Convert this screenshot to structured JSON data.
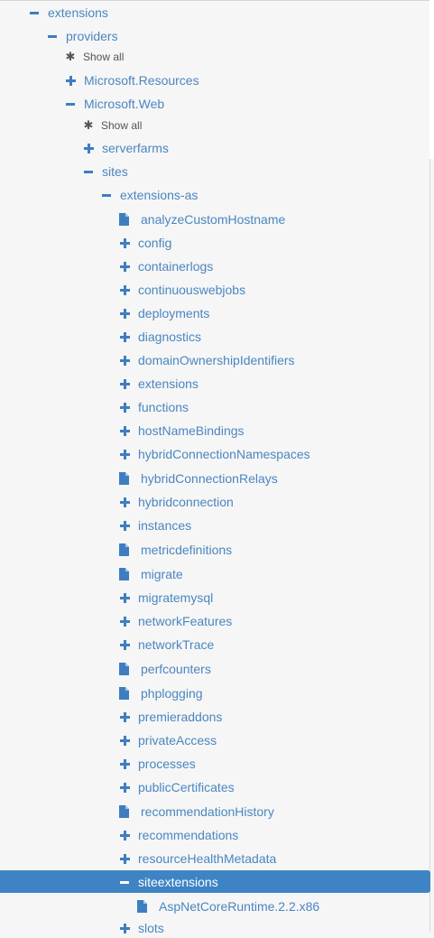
{
  "tree": [
    {
      "label": "extensions",
      "icon": "minus",
      "level": 0
    },
    {
      "label": "providers",
      "icon": "minus",
      "level": 1
    },
    {
      "label": "Show all",
      "icon": "star",
      "level": 2
    },
    {
      "label": "Microsoft.Resources",
      "icon": "plus",
      "level": 2
    },
    {
      "label": "Microsoft.Web",
      "icon": "minus",
      "level": 2
    },
    {
      "label": "Show all",
      "icon": "star",
      "level": 3
    },
    {
      "label": "serverfarms",
      "icon": "plus",
      "level": 3
    },
    {
      "label": "sites",
      "icon": "minus",
      "level": 3
    },
    {
      "label": "extensions-as",
      "icon": "minus",
      "level": 4
    },
    {
      "label": "analyzeCustomHostname",
      "icon": "file",
      "level": 5
    },
    {
      "label": "config",
      "icon": "plus",
      "level": 5
    },
    {
      "label": "containerlogs",
      "icon": "plus",
      "level": 5
    },
    {
      "label": "continuouswebjobs",
      "icon": "plus",
      "level": 5
    },
    {
      "label": "deployments",
      "icon": "plus",
      "level": 5
    },
    {
      "label": "diagnostics",
      "icon": "plus",
      "level": 5
    },
    {
      "label": "domainOwnershipIdentifiers",
      "icon": "plus",
      "level": 5
    },
    {
      "label": "extensions",
      "icon": "plus",
      "level": 5
    },
    {
      "label": "functions",
      "icon": "plus",
      "level": 5
    },
    {
      "label": "hostNameBindings",
      "icon": "plus",
      "level": 5
    },
    {
      "label": "hybridConnectionNamespaces",
      "icon": "plus",
      "level": 5
    },
    {
      "label": "hybridConnectionRelays",
      "icon": "file",
      "level": 5
    },
    {
      "label": "hybridconnection",
      "icon": "plus",
      "level": 5
    },
    {
      "label": "instances",
      "icon": "plus",
      "level": 5
    },
    {
      "label": "metricdefinitions",
      "icon": "file",
      "level": 5
    },
    {
      "label": "migrate",
      "icon": "file",
      "level": 5
    },
    {
      "label": "migratemysql",
      "icon": "plus",
      "level": 5
    },
    {
      "label": "networkFeatures",
      "icon": "plus",
      "level": 5
    },
    {
      "label": "networkTrace",
      "icon": "plus",
      "level": 5
    },
    {
      "label": "perfcounters",
      "icon": "file",
      "level": 5
    },
    {
      "label": "phplogging",
      "icon": "file",
      "level": 5
    },
    {
      "label": "premieraddons",
      "icon": "plus",
      "level": 5
    },
    {
      "label": "privateAccess",
      "icon": "plus",
      "level": 5
    },
    {
      "label": "processes",
      "icon": "plus",
      "level": 5
    },
    {
      "label": "publicCertificates",
      "icon": "plus",
      "level": 5
    },
    {
      "label": "recommendationHistory",
      "icon": "file",
      "level": 5
    },
    {
      "label": "recommendations",
      "icon": "plus",
      "level": 5
    },
    {
      "label": "resourceHealthMetadata",
      "icon": "plus",
      "level": 5
    },
    {
      "label": "siteextensions",
      "icon": "minus",
      "level": 5,
      "selected": true
    },
    {
      "label": "AspNetCoreRuntime.2.2.x86",
      "icon": "file",
      "level": 6
    },
    {
      "label": "slots",
      "icon": "plus",
      "level": 5
    }
  ]
}
